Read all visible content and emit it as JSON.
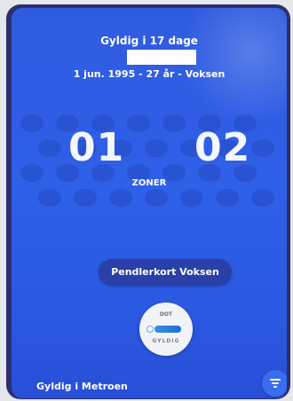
{
  "ticket": {
    "valid_days": "Gyldig i 17 dage",
    "birth_line": "1 jun. 1995 - 27 år - Voksen",
    "zone_from": "01",
    "zone_to": "02",
    "zones_label": "ZONER",
    "product_label": "Pendlerkort Voksen",
    "badge": {
      "top_text": "DOT",
      "bottom_text": "GYLDIG"
    },
    "footer_text": "Gyldig i Metroen"
  },
  "icons": {
    "menu": "menu-icon"
  },
  "colors": {
    "background": "#2f5be0",
    "pill": "#2a3fa8",
    "accent": "#3a6cf0",
    "badge": "#f2f3f7"
  }
}
